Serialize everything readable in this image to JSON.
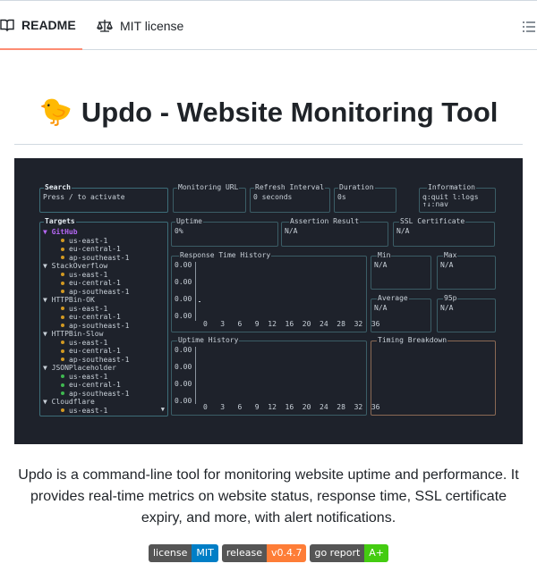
{
  "tabs": {
    "readme_label": "README",
    "license_label": "MIT license"
  },
  "heading": {
    "emoji": "🐤",
    "title": "Updo - Website Monitoring Tool"
  },
  "terminal": {
    "search": {
      "title": "Search",
      "text": "Press / to activate"
    },
    "monitoring_url": {
      "title": "Monitoring URL",
      "text": ""
    },
    "refresh_interval": {
      "title": "Refresh Interval",
      "text": "0 seconds"
    },
    "duration": {
      "title": "Duration",
      "text": "0s"
    },
    "information": {
      "title": "Information",
      "line1": "q:quit l:logs",
      "line2": "↑↓:nav"
    },
    "targets": {
      "title": "Targets",
      "rows": [
        {
          "text": "▼ GitHub",
          "kind": "sel"
        },
        {
          "text": "us-east-1",
          "kind": "region",
          "dot": "y"
        },
        {
          "text": "eu-central-1",
          "kind": "region",
          "dot": "y"
        },
        {
          "text": "ap-southeast-1",
          "kind": "region",
          "dot": "y"
        },
        {
          "text": "▼ StackOverflow",
          "kind": "site"
        },
        {
          "text": "us-east-1",
          "kind": "region",
          "dot": "y"
        },
        {
          "text": "eu-central-1",
          "kind": "region",
          "dot": "y"
        },
        {
          "text": "ap-southeast-1",
          "kind": "region",
          "dot": "y"
        },
        {
          "text": "▼ HTTPBin-OK",
          "kind": "site"
        },
        {
          "text": "us-east-1",
          "kind": "region",
          "dot": "y"
        },
        {
          "text": "eu-central-1",
          "kind": "region",
          "dot": "y"
        },
        {
          "text": "ap-southeast-1",
          "kind": "region",
          "dot": "y"
        },
        {
          "text": "▼ HTTPBin-Slow",
          "kind": "site"
        },
        {
          "text": "us-east-1",
          "kind": "region",
          "dot": "y"
        },
        {
          "text": "eu-central-1",
          "kind": "region",
          "dot": "y"
        },
        {
          "text": "ap-southeast-1",
          "kind": "region",
          "dot": "y"
        },
        {
          "text": "▼ JSONPlaceholder",
          "kind": "site"
        },
        {
          "text": "us-east-1",
          "kind": "region",
          "dot": "g"
        },
        {
          "text": "eu-central-1",
          "kind": "region",
          "dot": "g"
        },
        {
          "text": "ap-southeast-1",
          "kind": "region",
          "dot": "g"
        },
        {
          "text": "▼ Cloudflare",
          "kind": "site"
        },
        {
          "text": "us-east-1",
          "kind": "region",
          "dot": "y"
        }
      ],
      "scroll_arrow": "▼"
    },
    "uptime": {
      "title": "Uptime",
      "text": "0%"
    },
    "assertion": {
      "title": "Assertion Result",
      "text": "N/A"
    },
    "ssl": {
      "title": "SSL Certificate",
      "text": "N/A"
    },
    "response_history": {
      "title": "Response Time History",
      "y_ticks": [
        "0.00",
        "0.00",
        "0.00",
        "0.00"
      ],
      "x_ticks": "0   3   6   9  12  16  20  24  28  32  36"
    },
    "min": {
      "title": "Min",
      "text": "N/A"
    },
    "max": {
      "title": "Max",
      "text": "N/A"
    },
    "average": {
      "title": "Average",
      "text": "N/A"
    },
    "p95": {
      "title": "95p",
      "text": "N/A"
    },
    "uptime_history": {
      "title": "Uptime History",
      "y_ticks": [
        "0.00",
        "0.00",
        "0.00",
        "0.00"
      ],
      "x_ticks": "0   3   6   9  12  16  20  24  28  32  36"
    },
    "timing": {
      "title": "Timing Breakdown"
    }
  },
  "description": "Updo is a command-line tool for monitoring website uptime and performance. It provides real-time metrics on website status, response time, SSL certificate expiry, and more, with alert notifications.",
  "badges": [
    {
      "label": "license",
      "value": "MIT",
      "color": "#007ec6"
    },
    {
      "label": "release",
      "value": "v0.4.7",
      "color": "#fe7d37"
    },
    {
      "label": "go report",
      "value": "A+",
      "color": "#4c1"
    }
  ]
}
